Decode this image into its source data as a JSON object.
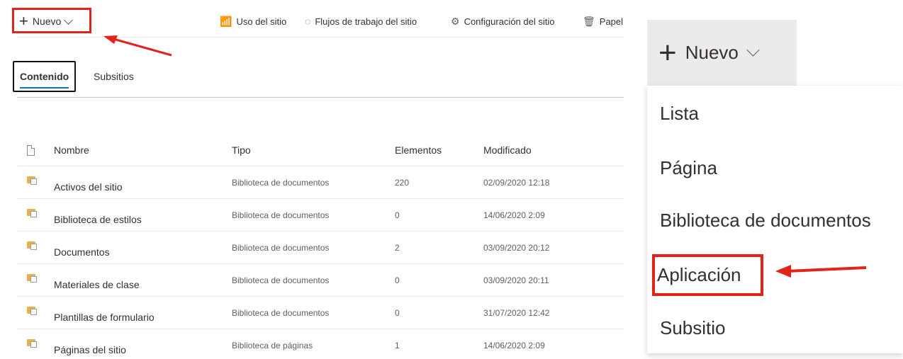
{
  "command_bar": {
    "new_label": "Nuevo",
    "site_usage_label": "Uso del sitio",
    "workflows_label": "Flujos de trabajo del sitio",
    "settings_label": "Configuración del sitio",
    "recycle_label": "Papel"
  },
  "tabs": [
    {
      "label": "Contenido",
      "selected": true
    },
    {
      "label": "Subsitios",
      "selected": false
    }
  ],
  "table": {
    "headers": {
      "name": "Nombre",
      "type": "Tipo",
      "items": "Elementos",
      "modified": "Modificado"
    },
    "rows": [
      {
        "name": "Activos del sitio",
        "type": "Biblioteca de documentos",
        "items": "220",
        "modified": "02/09/2020 12:18"
      },
      {
        "name": "Biblioteca de estilos",
        "type": "Biblioteca de documentos",
        "items": "0",
        "modified": "14/06/2020 2:09"
      },
      {
        "name": "Documentos",
        "type": "Biblioteca de documentos",
        "items": "2",
        "modified": "03/09/2020 20:12"
      },
      {
        "name": "Materiales de clase",
        "type": "Biblioteca de documentos",
        "items": "0",
        "modified": "03/09/2020 20:11"
      },
      {
        "name": "Plantillas de formulario",
        "type": "Biblioteca de documentos",
        "items": "0",
        "modified": "31/07/2020 12:42"
      },
      {
        "name": "Páginas del sitio",
        "type": "Biblioteca de páginas",
        "items": "1",
        "modified": "14/06/2020 2:09"
      }
    ]
  },
  "new_menu": {
    "button_label": "Nuevo",
    "items": [
      "Lista",
      "Página",
      "Biblioteca de documentos",
      "Aplicación",
      "Subsitio"
    ]
  },
  "colors": {
    "highlight": "#e2231a",
    "accent": "#0078d4"
  }
}
